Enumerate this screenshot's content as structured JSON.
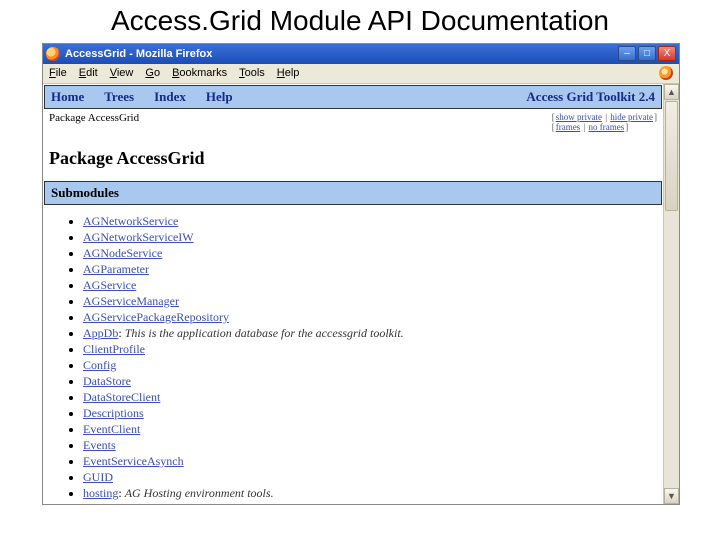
{
  "slideTitle": "Access.Grid Module API Documentation",
  "browser": {
    "windowTitle": "AccessGrid - Mozilla Firefox",
    "menus": [
      "File",
      "Edit",
      "View",
      "Go",
      "Bookmarks",
      "Tools",
      "Help"
    ],
    "winbtns": {
      "min": "–",
      "max": "□",
      "close": "X"
    }
  },
  "nav": {
    "links": [
      "Home",
      "Trees",
      "Index",
      "Help"
    ],
    "toolkit": "Access Grid Toolkit 2.4"
  },
  "breadcrumb": {
    "text": "Package AccessGrid",
    "tags": {
      "row1": [
        {
          "label": "show private",
          "active": false
        },
        {
          "label": "hide private",
          "active": true
        }
      ],
      "row2": [
        {
          "label": "frames"
        },
        {
          "label": "no frames"
        }
      ]
    }
  },
  "heading": "Package AccessGrid",
  "sectionTitle": "Submodules",
  "modules": [
    {
      "name": "AGNetworkService"
    },
    {
      "name": "AGNetworkServiceIW"
    },
    {
      "name": "AGNodeService"
    },
    {
      "name": "AGParameter"
    },
    {
      "name": "AGService"
    },
    {
      "name": "AGServiceManager"
    },
    {
      "name": "AGServicePackageRepository"
    },
    {
      "name": "AppDb",
      "desc": "This is the application database for the accessgrid toolkit."
    },
    {
      "name": "ClientProfile"
    },
    {
      "name": "Config"
    },
    {
      "name": "DataStore"
    },
    {
      "name": "DataStoreClient"
    },
    {
      "name": "Descriptions"
    },
    {
      "name": "EventClient"
    },
    {
      "name": "Events"
    },
    {
      "name": "EventServiceAsynch"
    },
    {
      "name": "GUID"
    },
    {
      "name": "hosting",
      "desc": "AG Hosting environment tools."
    }
  ]
}
